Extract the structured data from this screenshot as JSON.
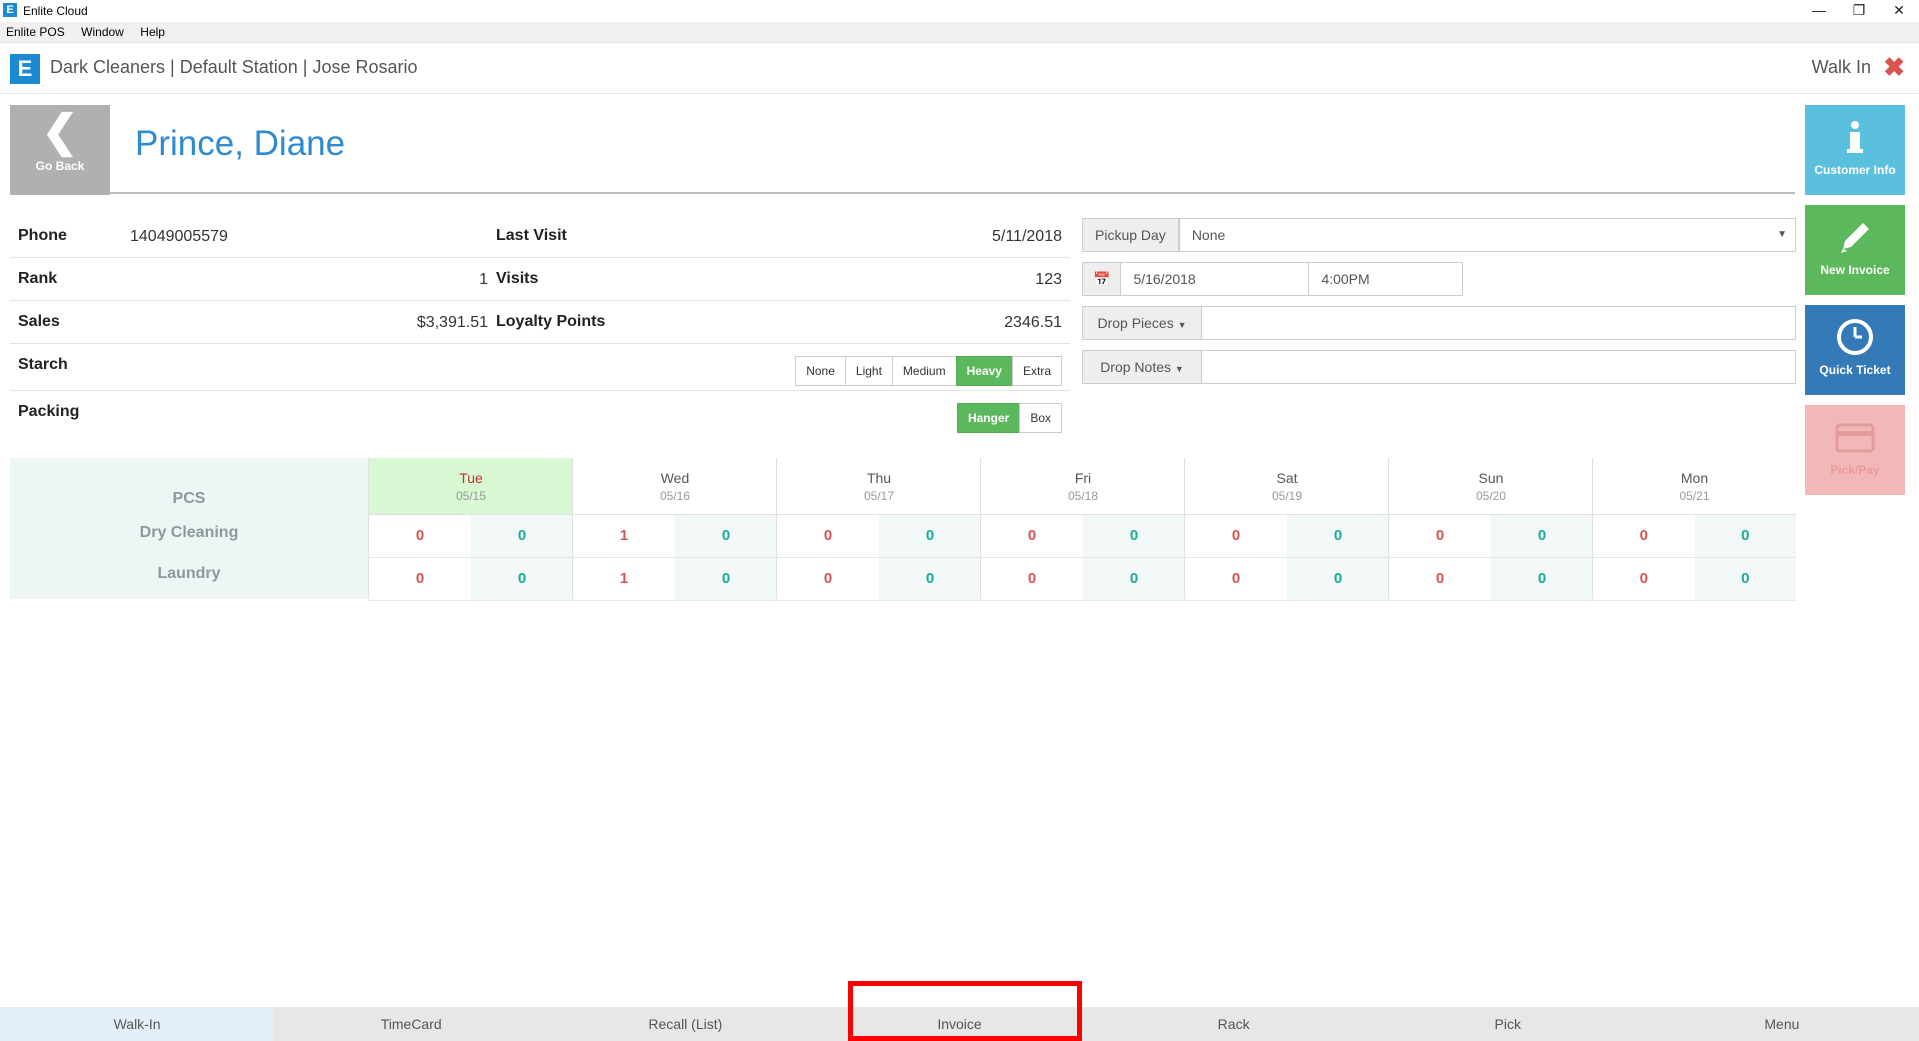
{
  "window": {
    "title": "Enlite Cloud",
    "menu": [
      "Enlite POS",
      "Window",
      "Help"
    ],
    "icon_letter": "E"
  },
  "header": {
    "title": "Dark Cleaners | Default Station | Jose Rosario",
    "mode": "Walk In",
    "logo_letter": "E"
  },
  "customer": {
    "name": "Prince, Diane",
    "go_back": "Go Back"
  },
  "info": {
    "phone_label": "Phone",
    "phone": "14049005579",
    "last_visit_label": "Last Visit",
    "last_visit": "5/11/2018",
    "rank_label": "Rank",
    "rank": "1",
    "visits_label": "Visits",
    "visits": "123",
    "sales_label": "Sales",
    "sales": "$3,391.51",
    "loyalty_label": "Loyalty Points",
    "loyalty": "2346.51",
    "starch_label": "Starch",
    "starch_options": [
      "None",
      "Light",
      "Medium",
      "Heavy",
      "Extra"
    ],
    "starch_selected": "Heavy",
    "packing_label": "Packing",
    "packing_options": [
      "Hanger",
      "Box"
    ],
    "packing_selected": "Hanger"
  },
  "form": {
    "pickup_day_label": "Pickup Day",
    "pickup_day_value": "None",
    "date": "5/16/2018",
    "time": "4:00PM",
    "drop_pieces_label": "Drop Pieces",
    "drop_notes_label": "Drop Notes"
  },
  "side_buttons": {
    "customer_info": "Customer Info",
    "new_invoice": "New Invoice",
    "quick_ticket": "Quick Ticket",
    "pick_pay": "Pick/Pay"
  },
  "schedule": {
    "pcs_label": "PCS",
    "rows": [
      "Dry Cleaning",
      "Laundry"
    ],
    "days": [
      {
        "name": "Tue",
        "date": "05/15",
        "dry": [
          "0",
          "0"
        ],
        "laundry": [
          "0",
          "0"
        ]
      },
      {
        "name": "Wed",
        "date": "05/16",
        "dry": [
          "1",
          "0"
        ],
        "laundry": [
          "1",
          "0"
        ]
      },
      {
        "name": "Thu",
        "date": "05/17",
        "dry": [
          "0",
          "0"
        ],
        "laundry": [
          "0",
          "0"
        ]
      },
      {
        "name": "Fri",
        "date": "05/18",
        "dry": [
          "0",
          "0"
        ],
        "laundry": [
          "0",
          "0"
        ]
      },
      {
        "name": "Sat",
        "date": "05/19",
        "dry": [
          "0",
          "0"
        ],
        "laundry": [
          "0",
          "0"
        ]
      },
      {
        "name": "Sun",
        "date": "05/20",
        "dry": [
          "0",
          "0"
        ],
        "laundry": [
          "0",
          "0"
        ]
      },
      {
        "name": "Mon",
        "date": "05/21",
        "dry": [
          "0",
          "0"
        ],
        "laundry": [
          "0",
          "0"
        ]
      }
    ]
  },
  "bottom_nav": [
    "Walk-In",
    "TimeCard",
    "Recall (List)",
    "Invoice",
    "Rack",
    "Pick",
    "Menu"
  ],
  "colors": {
    "accent": "#2f8bd1",
    "customer_info": "#5bc0de",
    "new_invoice": "#5cb85c",
    "quick_ticket": "#337ab7",
    "pick_pay": "#f2b8b8",
    "highlight": "#ff0000"
  }
}
